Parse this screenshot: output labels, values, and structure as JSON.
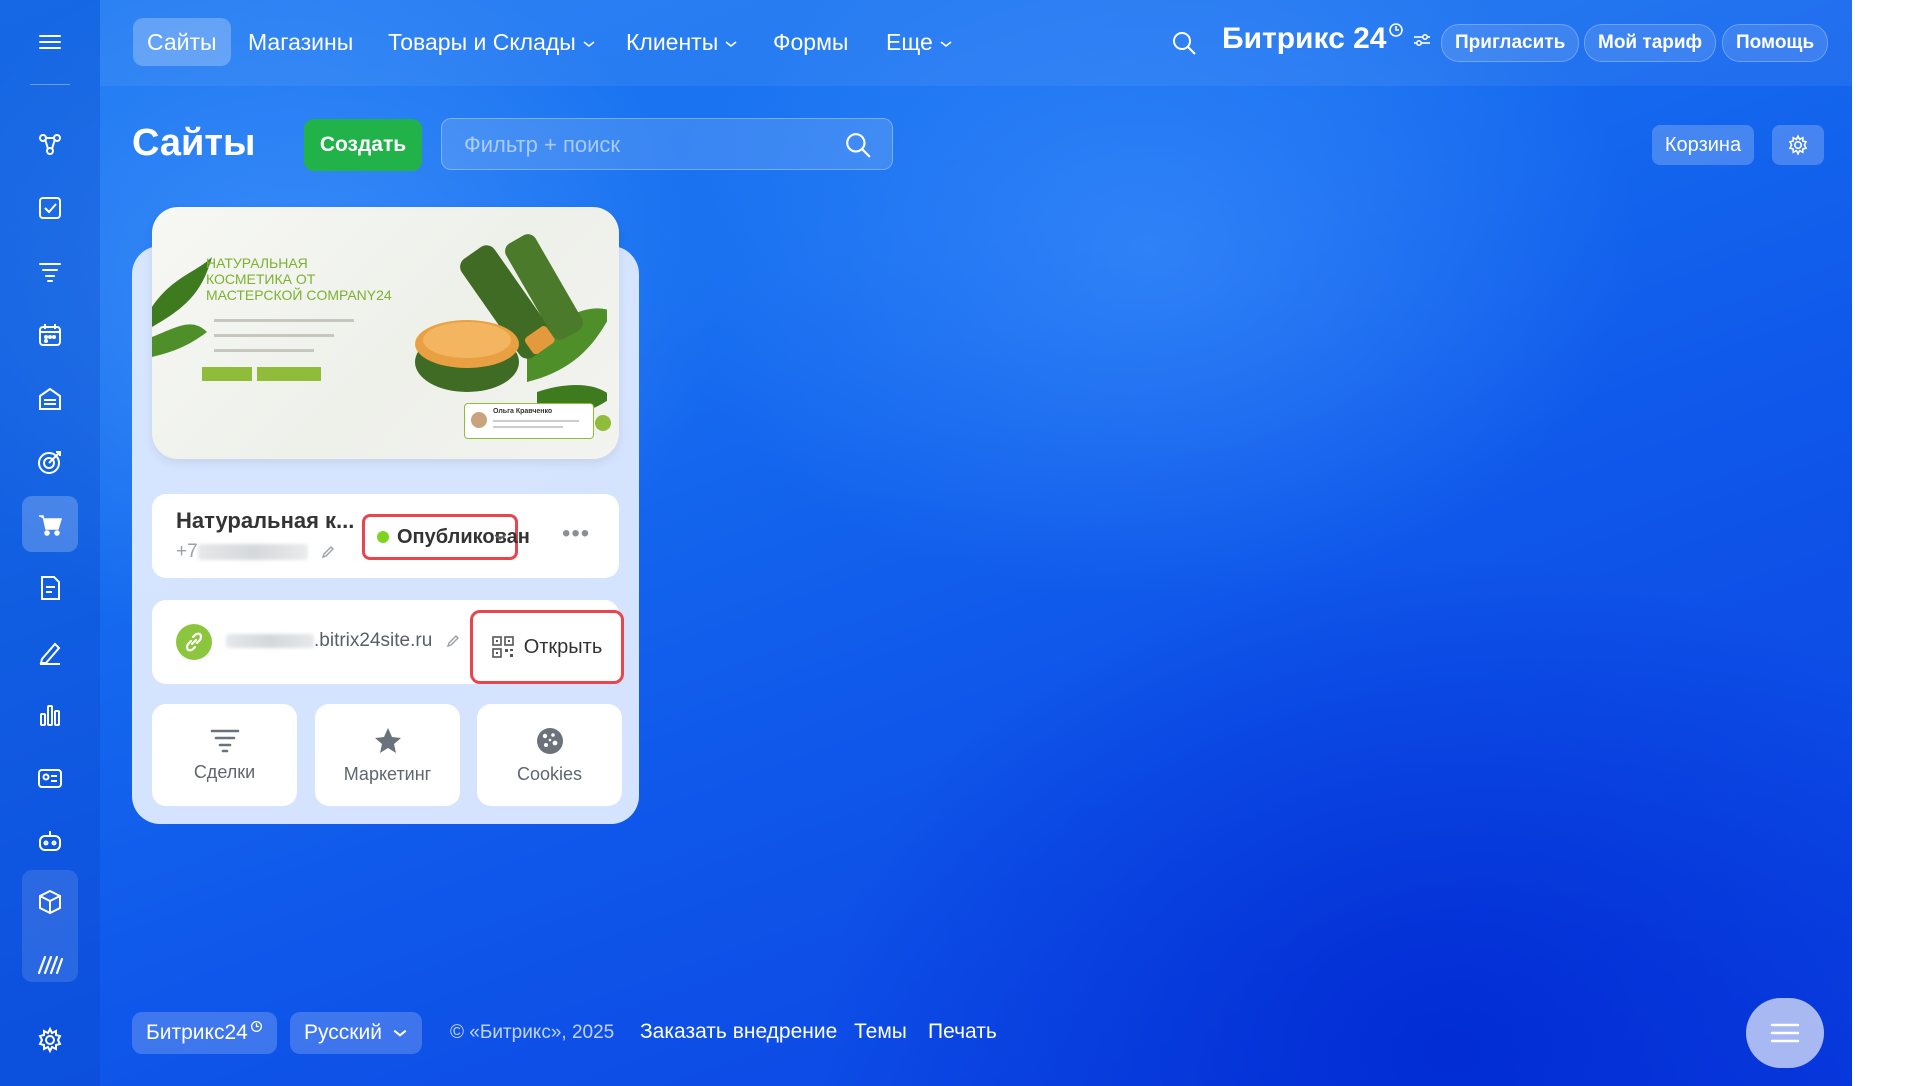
{
  "topnav": {
    "items": [
      {
        "label": "Сайты",
        "active": true
      },
      {
        "label": "Магазины"
      },
      {
        "label": "Товары и Склады",
        "dropdown": true
      },
      {
        "label": "Клиенты",
        "dropdown": true
      },
      {
        "label": "Формы"
      },
      {
        "label": "Еще",
        "dropdown": true
      }
    ],
    "brand": "Битрикс 24",
    "invite_label": "Пригласить",
    "tariff_label": "Мой тариф",
    "help_label": "Помощь"
  },
  "page": {
    "title": "Сайты",
    "create_label": "Создать",
    "search_placeholder": "Фильтр + поиск",
    "trash_label": "Корзина"
  },
  "site_card": {
    "preview": {
      "headline": "НАТУРАЛЬНАЯ КОСМЕТИКА ОТ МАСТЕРСКОЙ COMPANY24",
      "review_name": "Ольга Кравченко"
    },
    "name": "Натуральная к...",
    "phone_prefix": "+7",
    "status": "Опубликован",
    "domain_suffix": ".bitrix24site.ru",
    "open_label": "Открыть",
    "tiles": [
      {
        "label": "Сделки",
        "icon": "funnel-icon"
      },
      {
        "label": "Маркетинг",
        "icon": "star-icon"
      },
      {
        "label": "Cookies",
        "icon": "cookie-icon"
      }
    ]
  },
  "footer": {
    "brand_label": "Битрикс24",
    "language_label": "Русский",
    "copyright": "© «Битрикс», 2025",
    "order_link": "Заказать внедрение",
    "themes_link": "Темы",
    "print_link": "Печать"
  },
  "colors": {
    "accent_green": "#21b34a",
    "highlight_red": "#e8454f",
    "status_green": "#7ed321",
    "link_green": "#8cc63f"
  }
}
